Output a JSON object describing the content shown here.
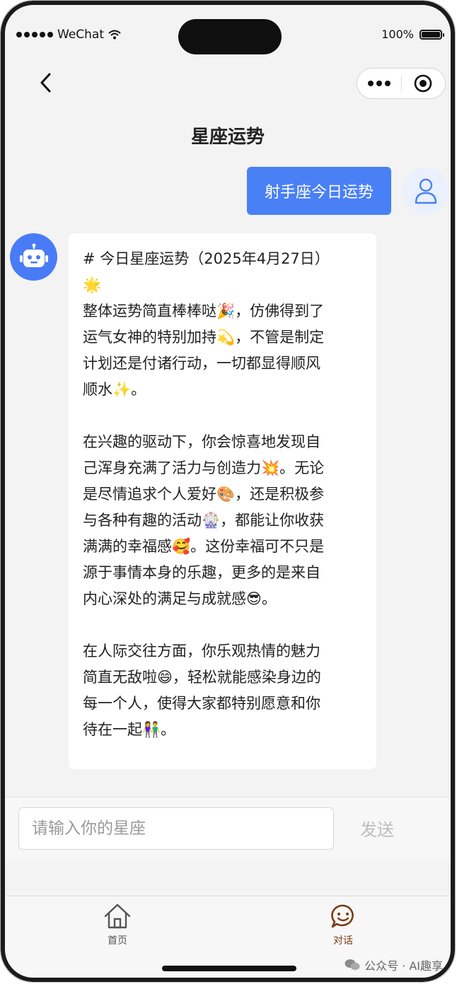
{
  "status_bar": {
    "carrier": "WeChat",
    "battery_percent": "100%",
    "battery_level": 1.0
  },
  "nav": {
    "title": "星座运势"
  },
  "chat": {
    "user_message": "射手座今日运势",
    "bot_lines": [
      "# 今日星座运势（2025年4月27日）",
      "🌟",
      "整体运势简直棒棒哒🎉，仿佛得到了",
      "运气女神的特别加持💫，不管是制定",
      "计划还是付诸行动，一切都显得顺风",
      "顺水✨。",
      "",
      "在兴趣的驱动下，你会惊喜地发现自",
      "己浑身充满了活力与创造力💥。无论",
      "是尽情追求个人爱好🎨，还是积极参",
      "与各种有趣的活动🎡，都能让你收获",
      "满满的幸福感🥰。这份幸福可不只是",
      "源于事情本身的乐趣，更多的是来自",
      "内心深处的满足与成就感😎。",
      "",
      "在人际交往方面，你乐观热情的魅力",
      "简直无敌啦😄，轻松就能感染身边的",
      "每一个人，使得大家都特别愿意和你",
      "待在一起👫。"
    ]
  },
  "input_bar": {
    "placeholder": "请输入你的星座",
    "value": "",
    "send_label": "发送"
  },
  "tabbar": {
    "items": [
      {
        "label": "首页",
        "icon": "home-icon",
        "active": false
      },
      {
        "label": "对话",
        "icon": "chat-smile-icon",
        "active": true
      }
    ]
  },
  "watermark": {
    "text": "公众号 · AI趣享"
  },
  "colors": {
    "accent_blue": "#4a80f6",
    "active_tab": "#7a3b12",
    "inactive_tab": "#555555",
    "send_disabled": "#bdbdbd"
  }
}
